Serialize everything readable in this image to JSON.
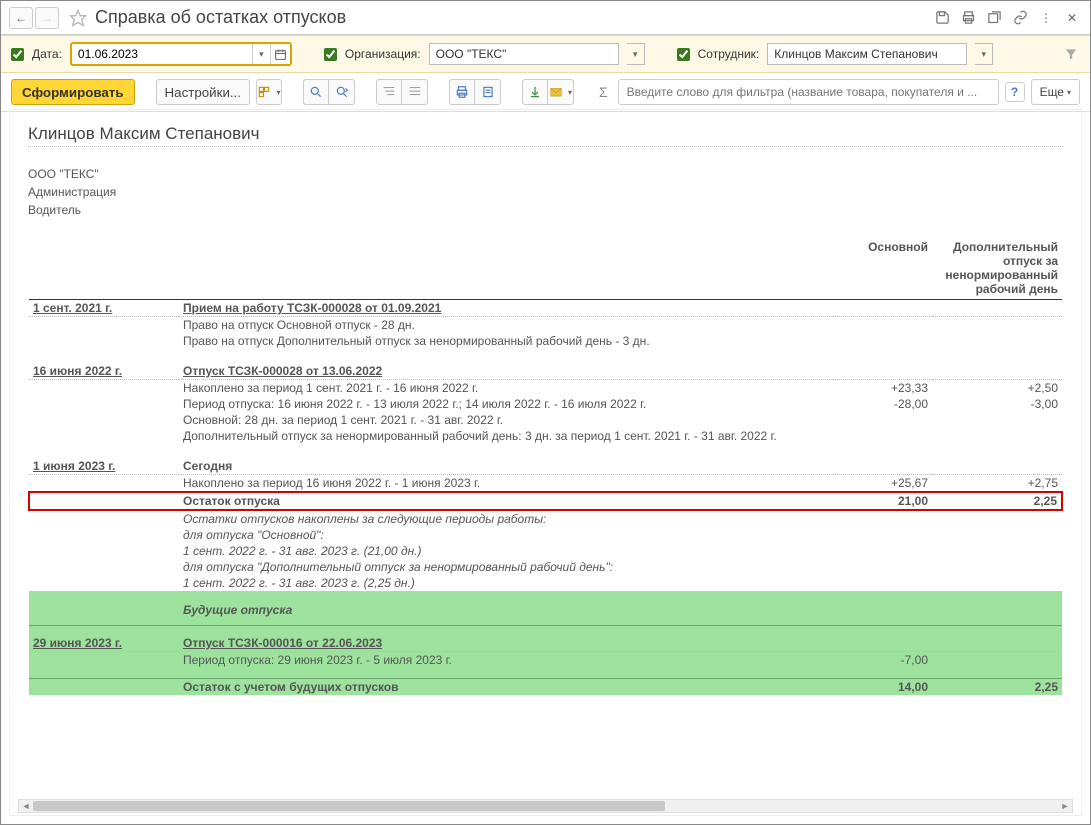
{
  "title": "Справка об остатках отпусков",
  "filters": {
    "date_label": "Дата:",
    "date_value": "01.06.2023",
    "org_label": "Организация:",
    "org_value": "ООО \"ТЕКС\"",
    "emp_label": "Сотрудник:",
    "emp_value": "Клинцов Максим Степанович"
  },
  "toolbar": {
    "generate": "Сформировать",
    "settings": "Настройки...",
    "filter_placeholder": "Введите слово для фильтра (название товара, покупателя и ...",
    "more": "Еще"
  },
  "report": {
    "employee": "Клинцов Максим Степанович",
    "org": "ООО \"ТЕКС\"",
    "dept": "Администрация",
    "position": "Водитель",
    "col_main": "Основной",
    "col_extra": "Дополнительный отпуск за ненормированный рабочий день",
    "rows": [
      {
        "date": "1 сент. 2021 г.",
        "title": "Прием на работу ТСЗК-000028 от 01.09.2021",
        "lines": [
          "Право на отпуск Основной отпуск - 28 дн.",
          "Право на отпуск Дополнительный отпуск за ненормированный рабочий день - 3 дн."
        ]
      },
      {
        "date": "16 июня 2022 г.",
        "title": "Отпуск ТСЗК-000028 от 13.06.2022",
        "l1": "Накоплено за период 1 сент. 2021 г. - 16 июня 2022 г.",
        "v1a": "+23,33",
        "v1b": "+2,50",
        "l2a": "Период отпуска: 16 июня 2022 г. - 13 июля 2022 г.; 14 июля 2022 г. - 16 июля 2022 г.",
        "v2a": "-28,00",
        "v2b": "-3,00",
        "l3": "Основной: 28 дн. за период 1 сент. 2021 г. - 31 авг. 2022 г.",
        "l4": "Дополнительный отпуск за ненормированный рабочий день: 3 дн. за период 1 сент. 2021 г. - 31 авг. 2022 г."
      },
      {
        "date": "1 июня 2023 г.",
        "title": "Сегодня",
        "l1": "Накоплено за период 16 июня 2022 г. - 1 июня 2023 г.",
        "v1a": "+25,67",
        "v1b": "+2,75",
        "balance_label": "Остаток отпуска",
        "balance_a": "21,00",
        "balance_b": "2,25",
        "note0": "Остатки отпусков накоплены за следующие периоды работы:",
        "note1": "для отпуска \"Основной\":",
        "note1a": "1 сент. 2022 г. - 31 авг. 2023 г. (21,00 дн.)",
        "note2": "для отпуска \"Дополнительный отпуск за ненормированный рабочий день\":",
        "note2a": "1 сент. 2022 г. - 31 авг. 2023 г. (2,25 дн.)"
      }
    ],
    "future_header": "Будущие отпуска",
    "future": {
      "date": "29 июня 2023 г.",
      "title": "Отпуск ТСЗК-000016 от 22.06.2023",
      "period": "Период отпуска: 29 июня 2023 г. - 5 июля 2023 г.",
      "v": "-7,00"
    },
    "final_label": "Остаток с учетом будущих отпусков",
    "final_a": "14,00",
    "final_b": "2,25"
  }
}
